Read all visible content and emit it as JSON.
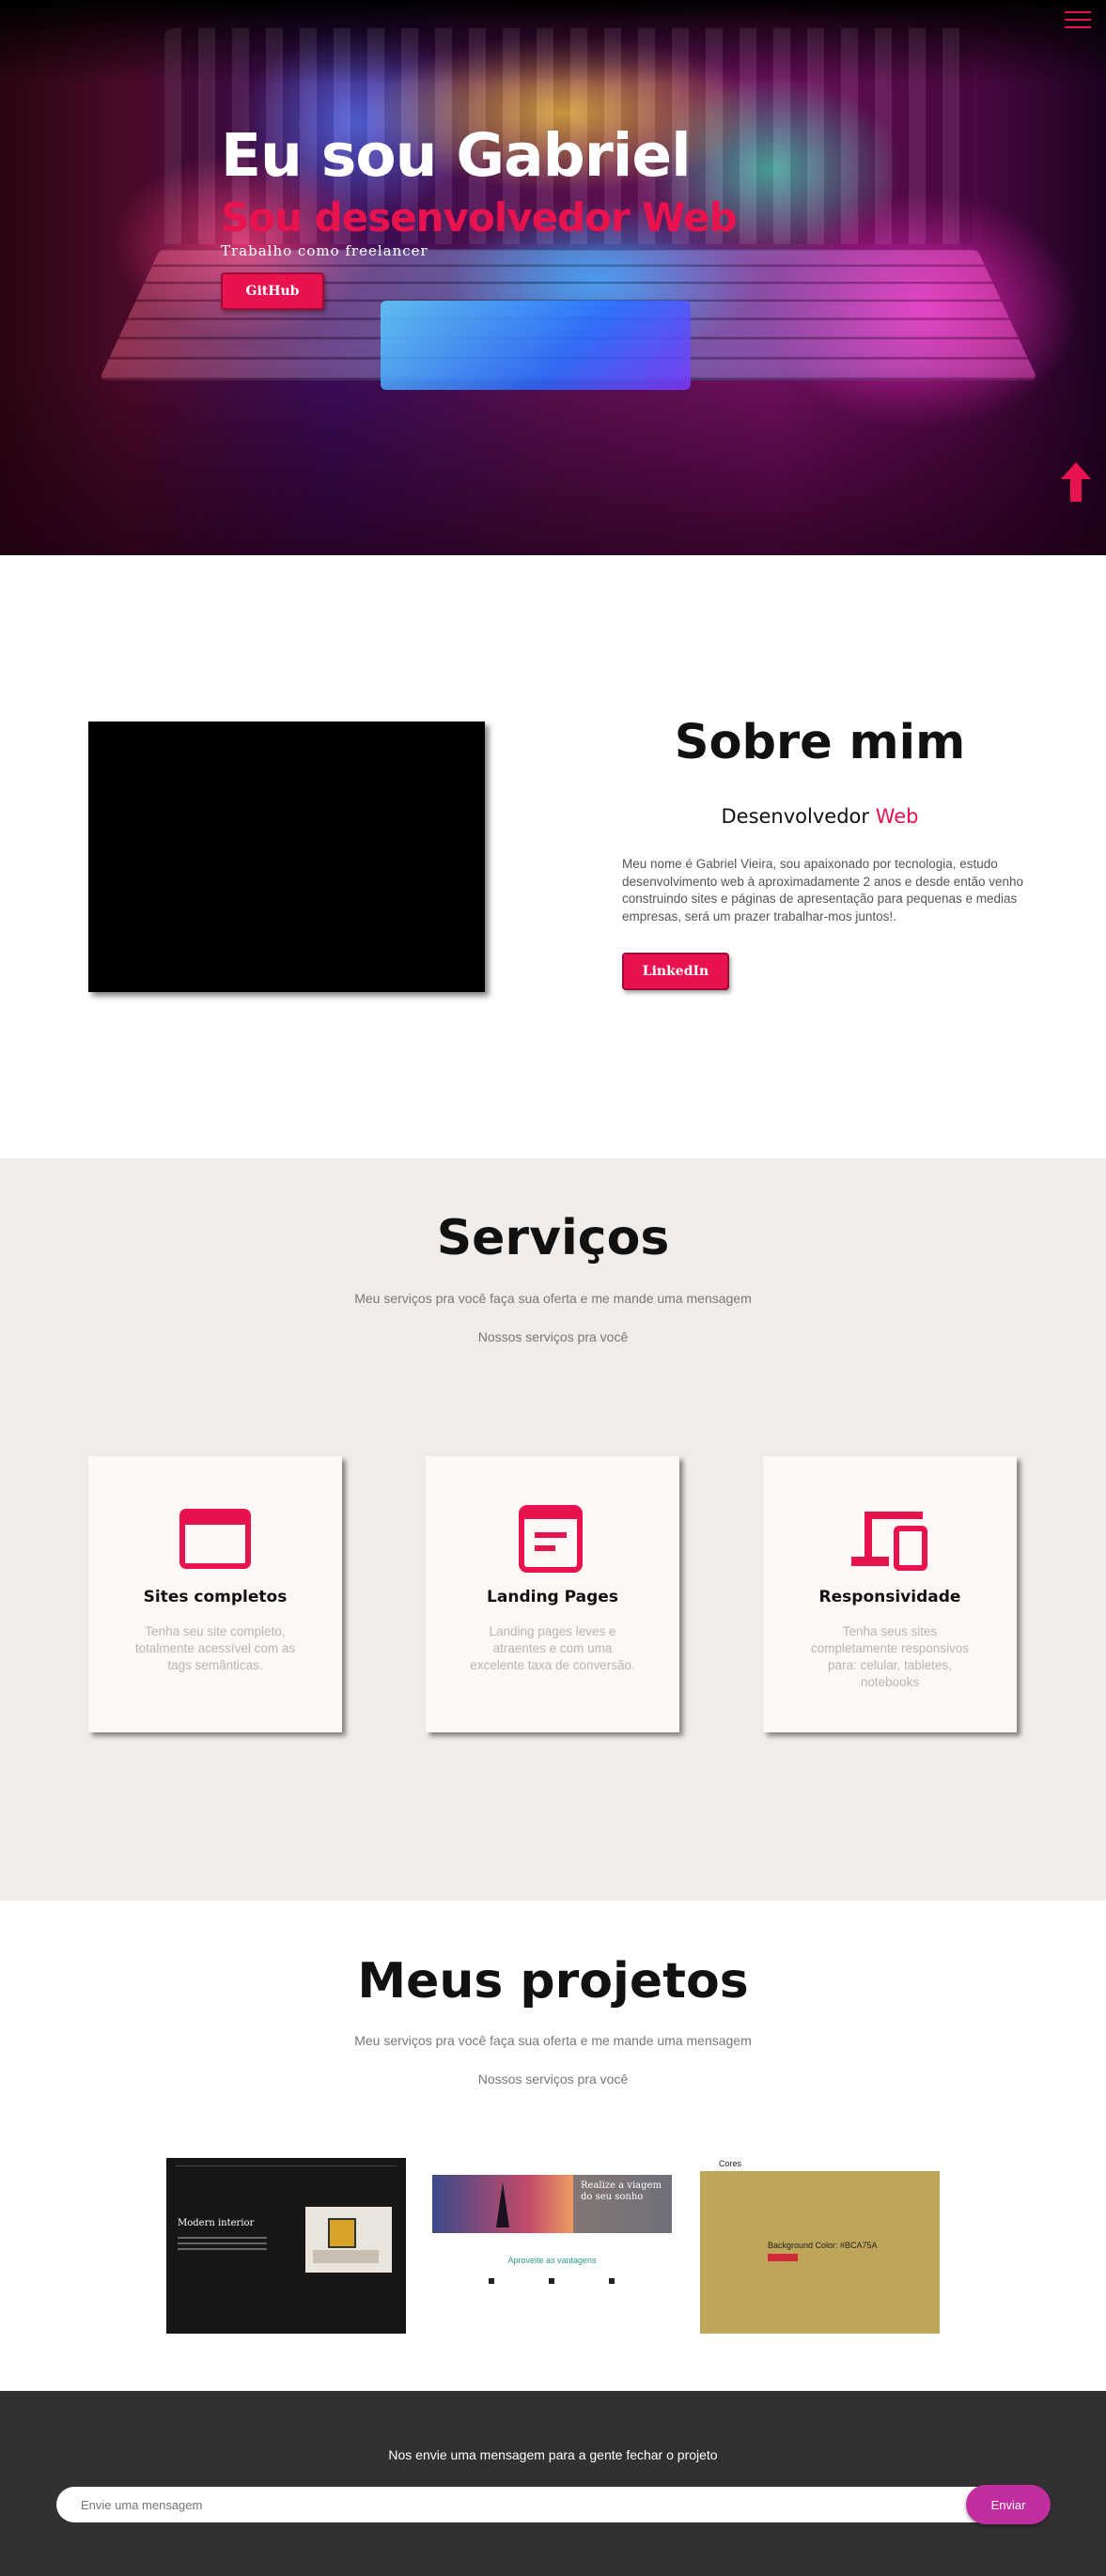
{
  "hero": {
    "title": "Eu sou Gabriel",
    "subtitle": "Sou desenvolvedor Web",
    "note": "Trabalho como freelancer",
    "github_label": "GitHub"
  },
  "about": {
    "title": "Sobre mim",
    "role_prefix": "Desenvolvedor ",
    "role_highlight": "Web",
    "text": "Meu nome é Gabriel Vieira, sou apaixonado por tecnologia, estudo desenvolvimento web à aproximadamente 2 anos e desde então venho construindo sites e páginas de apresentação para pequenas e medias empresas, será um prazer trabalhar-mos juntos!.",
    "linkedin_label": "LinkedIn"
  },
  "services": {
    "title": "Serviços",
    "subtitle": "Meu serviços pra você faça sua oferta e me mande uma mensagem",
    "caption": "Nossos serviços pra você",
    "cards": [
      {
        "icon": "browser-window-icon",
        "title": "Sites completos",
        "text": "Tenha seu site completo, totalmente acessível com as tags semânticas."
      },
      {
        "icon": "article-icon",
        "title": "Landing Pages",
        "text": "Landing pages leves e atraentes e com uma excelente taxa de conversão."
      },
      {
        "icon": "devices-icon",
        "title": "Responsividade",
        "text": "Tenha seus sites completamente responsivos para: celular, tabletes, notebooks"
      }
    ]
  },
  "projects": {
    "title": "Meus projetos",
    "subtitle": "Meu serviços pra você faça sua oferta e me mande uma mensagem",
    "caption": "Nossos serviços pra você",
    "thumbs": {
      "t1_heading": "Modern interior",
      "t2_heading": "Realize a viagem do seu sonho",
      "t2_sub": "Aproveite as vantagens",
      "t3_brand": "Cores",
      "t3_text": "Background Color: #BCA75A"
    }
  },
  "footer": {
    "title": "Nos envie uma mensagem para a gente fechar o projeto",
    "input_placeholder": "Envie uma mensagem",
    "send_label": "Enviar"
  },
  "colors": {
    "accent": "#e8124f",
    "send": "#c02ea0",
    "services_bg": "#f0ecea",
    "footer_bg": "#323030"
  }
}
